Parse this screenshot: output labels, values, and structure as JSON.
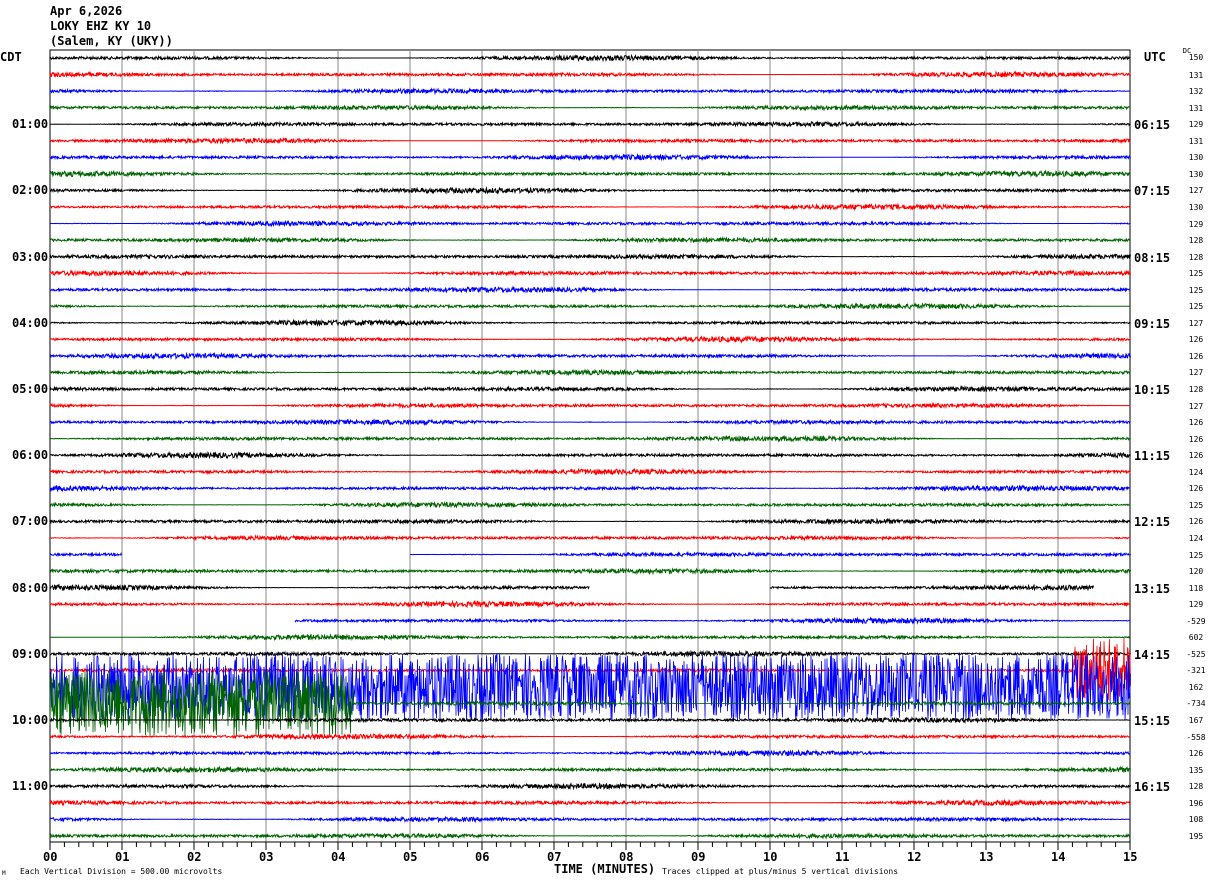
{
  "header": {
    "date": "Apr 6,2026",
    "station": "LOKY EHZ KY 10",
    "location": "(Salem, KY (UKY))"
  },
  "left_tz": "CDT",
  "right_tz": "UTC",
  "dc_header": "DC",
  "footer": {
    "x_axis_title": "TIME (MINUTES)",
    "scale_note": "Each Vertical Division =  500.00 microvolts",
    "clip_note": "Traces clipped at plus/minus 5 vertical divisions",
    "corner_mark": "M"
  },
  "chart_data": {
    "type": "line",
    "title": "LOKY EHZ KY 10 helicorder",
    "xlabel": "TIME (MINUTES)",
    "xlim": [
      0,
      15
    ],
    "x_ticks": [
      "00",
      "01",
      "02",
      "03",
      "04",
      "05",
      "06",
      "07",
      "08",
      "09",
      "10",
      "11",
      "12",
      "13",
      "14",
      "15"
    ],
    "colors": [
      "#000000",
      "#ff0000",
      "#0000ff",
      "#006400"
    ],
    "left_labels": [
      {
        "row": 4,
        "text": "01:00"
      },
      {
        "row": 8,
        "text": "02:00"
      },
      {
        "row": 12,
        "text": "03:00"
      },
      {
        "row": 16,
        "text": "04:00"
      },
      {
        "row": 20,
        "text": "05:00"
      },
      {
        "row": 24,
        "text": "06:00"
      },
      {
        "row": 28,
        "text": "07:00"
      },
      {
        "row": 32,
        "text": "08:00"
      },
      {
        "row": 36,
        "text": "09:00"
      },
      {
        "row": 40,
        "text": "10:00"
      },
      {
        "row": 44,
        "text": "11:00"
      }
    ],
    "right_labels": [
      {
        "row": 4,
        "text": "06:15"
      },
      {
        "row": 8,
        "text": "07:15"
      },
      {
        "row": 12,
        "text": "08:15"
      },
      {
        "row": 16,
        "text": "09:15"
      },
      {
        "row": 20,
        "text": "10:15"
      },
      {
        "row": 24,
        "text": "11:15"
      },
      {
        "row": 28,
        "text": "12:15"
      },
      {
        "row": 32,
        "text": "13:15"
      },
      {
        "row": 36,
        "text": "14:15"
      },
      {
        "row": 40,
        "text": "15:15"
      },
      {
        "row": 44,
        "text": "16:15"
      }
    ],
    "dc_offsets": [
      "150",
      "131",
      "132",
      "131",
      "129",
      "131",
      "130",
      "130",
      "127",
      "130",
      "129",
      "128",
      "128",
      "125",
      "125",
      "125",
      "127",
      "126",
      "126",
      "127",
      "128",
      "127",
      "126",
      "126",
      "126",
      "124",
      "126",
      "125",
      "126",
      "124",
      "125",
      "120",
      "118",
      "129",
      "-529",
      "602",
      "-525",
      "-321",
      "162",
      "-734",
      "167",
      "-558",
      "126",
      "135",
      "128",
      "196",
      "108",
      "195"
    ],
    "gaps": [
      {
        "row": 30,
        "from": 1.0,
        "to": 5.0
      },
      {
        "row": 32,
        "from": 7.5,
        "to": 10.0
      },
      {
        "row": 32,
        "from": 14.5,
        "to": 15
      },
      {
        "row": 34,
        "from": 0,
        "to": 3.4
      }
    ],
    "events": [
      {
        "row": 38,
        "from": 0,
        "to": 15,
        "clipped": true
      },
      {
        "row": 39,
        "from": 0,
        "to": 4.2,
        "clipped": true
      },
      {
        "row": 37,
        "from": 14.2,
        "to": 15,
        "clipped": true
      }
    ]
  }
}
